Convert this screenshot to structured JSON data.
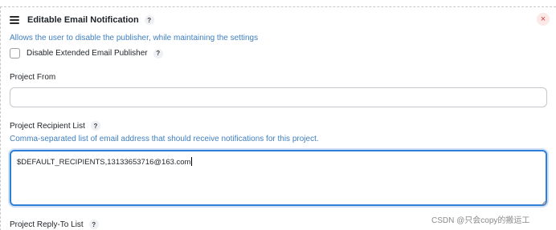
{
  "header": {
    "title": "Editable Email Notification",
    "help_symbol": "?",
    "close_symbol": "×"
  },
  "settings_description": "Allows the user to disable the publisher, while maintaining the settings",
  "disable_checkbox": {
    "label": "Disable Extended Email Publisher",
    "checked": false,
    "help_symbol": "?"
  },
  "project_from": {
    "label": "Project From",
    "value": ""
  },
  "recipient_list": {
    "label": "Project Recipient List",
    "help_symbol": "?",
    "description": "Comma-separated list of email address that should receive notifications for this project.",
    "value": "$DEFAULT_RECIPIENTS,13133653716@163.com"
  },
  "reply_to": {
    "label": "Project Reply-To List",
    "help_symbol": "?"
  },
  "watermark": "CSDN @只会copy的搬运工",
  "colors": {
    "link_blue": "#3f7fbf",
    "focus_border": "#2f7fd6",
    "close_red": "#d14141"
  }
}
